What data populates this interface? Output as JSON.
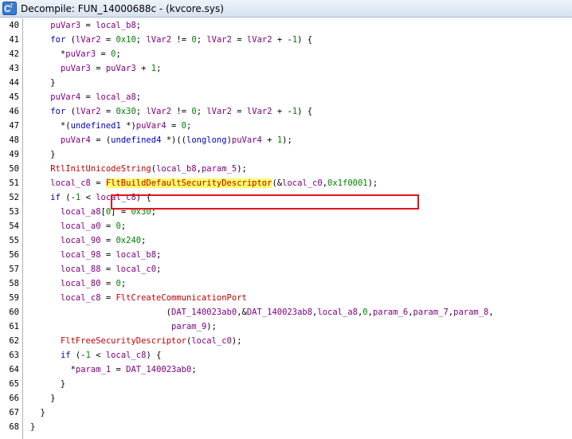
{
  "window": {
    "title": "Decompile: FUN_14000688c - (kvcore.sys)",
    "icon": "decompiler-icon"
  },
  "lines": [
    {
      "n": "40",
      "t": "    puVar3 = local_b8;"
    },
    {
      "n": "41",
      "t": "    for (lVar2 = 0x10; lVar2 != 0; lVar2 = lVar2 + -1) {"
    },
    {
      "n": "42",
      "t": "      *puVar3 = 0;"
    },
    {
      "n": "43",
      "t": "      puVar3 = puVar3 + 1;"
    },
    {
      "n": "44",
      "t": "    }"
    },
    {
      "n": "45",
      "t": "    puVar4 = local_a8;"
    },
    {
      "n": "46",
      "t": "    for (lVar2 = 0x30; lVar2 != 0; lVar2 = lVar2 + -1) {"
    },
    {
      "n": "47",
      "t": "      *(undefined1 *)puVar4 = 0;"
    },
    {
      "n": "48",
      "t": "      puVar4 = (undefined4 *)((longlong)puVar4 + 1);"
    },
    {
      "n": "49",
      "t": "    }"
    },
    {
      "n": "50",
      "t": "    RtlInitUnicodeString(local_b8,param_5);"
    },
    {
      "n": "51",
      "t": "    local_c8 = FltBuildDefaultSecurityDescriptor(&local_c0,0x1f0001);"
    },
    {
      "n": "52",
      "t": "    if (-1 < local_c8) {"
    },
    {
      "n": "53",
      "t": "      local_a8[0] = 0x30;"
    },
    {
      "n": "54",
      "t": "      local_a0 = 0;"
    },
    {
      "n": "55",
      "t": "      local_90 = 0x240;"
    },
    {
      "n": "56",
      "t": "      local_98 = local_b8;"
    },
    {
      "n": "57",
      "t": "      local_88 = local_c0;"
    },
    {
      "n": "58",
      "t": "      local_80 = 0;"
    },
    {
      "n": "59",
      "t": "      local_c8 = FltCreateCommunicationPort"
    },
    {
      "n": "60",
      "t": "                           (DAT_140023ab0,&DAT_140023ab8,local_a8,0,param_6,param_7,param_8,"
    },
    {
      "n": "61",
      "t": "                            param_9);"
    },
    {
      "n": "62",
      "t": "      FltFreeSecurityDescriptor(local_c0);"
    },
    {
      "n": "63",
      "t": "      if (-1 < local_c8) {"
    },
    {
      "n": "64",
      "t": "        *param_1 = DAT_140023ab0;"
    },
    {
      "n": "65",
      "t": "      }"
    },
    {
      "n": "66",
      "t": "    }"
    },
    {
      "n": "67",
      "t": "  }"
    },
    {
      "n": "68",
      "t": "}"
    }
  ],
  "highlight": {
    "line": "51",
    "function": "FltBuildDefaultSecurityDescriptor"
  }
}
